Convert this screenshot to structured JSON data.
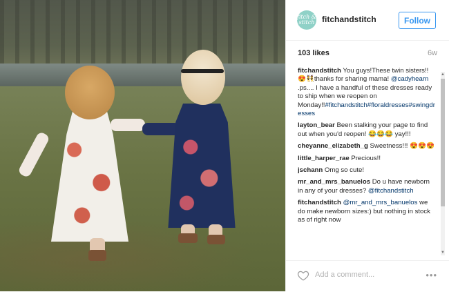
{
  "post": {
    "username": "fitchandstitch",
    "avatar_text": "fitch & stitch",
    "follow_label": "Follow",
    "likes": "103 likes",
    "age": "6w"
  },
  "comments": [
    {
      "user": "fitchandstitch",
      "parts": [
        {
          "text": " You guys!These twin sisters!!😍👯thanks for sharing mama! ",
          "tag": false
        },
        {
          "text": "@cadyhearn",
          "tag": true
        },
        {
          "text": " .ps.... I have a handful of these dresses ready to ship when we reopen on Monday!!",
          "tag": false
        },
        {
          "text": "#fitchandstitch#floraldresses#swingdresses",
          "tag": true
        }
      ]
    },
    {
      "user": "layton_bear",
      "parts": [
        {
          "text": " Been stalking your page to find out when you'd reopen! 😂😂😂 yay!!!",
          "tag": false
        }
      ]
    },
    {
      "user": "cheyanne_elizabeth_g",
      "parts": [
        {
          "text": " Sweetness!!! 😍😍😍",
          "tag": false
        }
      ]
    },
    {
      "user": "little_harper_rae",
      "parts": [
        {
          "text": " Precious!!",
          "tag": false
        }
      ]
    },
    {
      "user": "jschann",
      "parts": [
        {
          "text": " Omg so cute!",
          "tag": false
        }
      ]
    },
    {
      "user": "mr_and_mrs_banuelos",
      "parts": [
        {
          "text": " Do u have newborn in any of your dresses? ",
          "tag": false
        },
        {
          "text": "@fitchandstitch",
          "tag": true
        }
      ]
    },
    {
      "user": "fitchandstitch",
      "parts": [
        {
          "text": " ",
          "tag": false
        },
        {
          "text": "@mr_and_mrs_banuelos",
          "tag": true
        },
        {
          "text": " we do make newborn sizes:) but nothing in stock as of right now",
          "tag": false
        }
      ]
    }
  ],
  "footer": {
    "add_comment_placeholder": "Add a comment...",
    "more_label": "•••"
  },
  "icons": {
    "heart": "heart-icon",
    "more": "more-options-icon"
  },
  "colors": {
    "accent": "#3897f0",
    "hashtag": "#003569",
    "avatar_bg": "#8fd1c7"
  }
}
